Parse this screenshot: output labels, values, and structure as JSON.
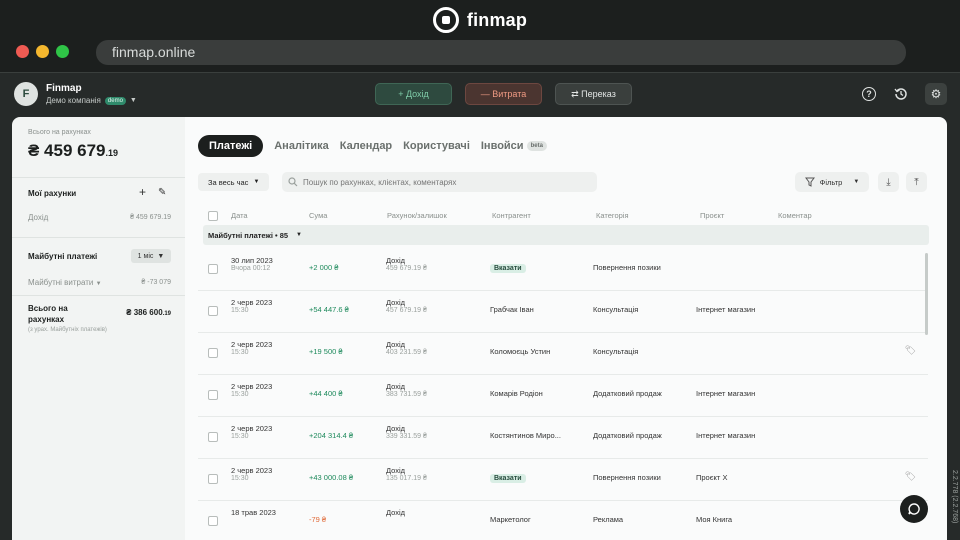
{
  "brand": {
    "name": "finmap"
  },
  "browser": {
    "url": "finmap.online"
  },
  "company": {
    "avatar": "F",
    "name": "Finmap",
    "sub": "Демо компанія",
    "badge": "demo"
  },
  "actions": {
    "income": "+ Дохід",
    "expense": "— Витрата",
    "transfer": "⇄ Переказ"
  },
  "sidebar": {
    "total_label": "Всього на рахунках",
    "total_main": "₴ 459 679",
    "total_cents": ".19",
    "accounts_title": "Мої рахунки",
    "accounts": [
      {
        "label": "Дохід",
        "value": "₴ 459 679.19"
      }
    ],
    "future_title": "Майбутні платежі",
    "future_period": "1 міс",
    "future_expense_label": "Майбутні витрати",
    "future_expense_value": "₴ -73 079",
    "sum_title": "Всього на рахунках",
    "sum_value": "₴ 386 600",
    "sum_cents": ".19",
    "sum_note": "(з урах. Майбутніх платежів)"
  },
  "tabs": [
    {
      "label": "Платежі"
    },
    {
      "label": "Аналітика"
    },
    {
      "label": "Календар"
    },
    {
      "label": "Користувачі"
    },
    {
      "label": "Інвойси",
      "badge": "beta"
    }
  ],
  "filters": {
    "period": "За весь час",
    "search_placeholder": "Пошук по рахунках, клієнтах, коментарях",
    "filter_label": "Фільтр"
  },
  "columns": [
    "Дата",
    "Сума",
    "Рахунок/залишок",
    "Контрагент",
    "Категорія",
    "Проєкт",
    "Коментар"
  ],
  "group": {
    "label": "Майбутні платежі • 85"
  },
  "rows": [
    {
      "date": "30 лип 2023",
      "time": "Вчора 00:12",
      "amount": "+2 000 ₴",
      "sign": "pos",
      "account": "Дохід",
      "balance": "459 679.19 ₴",
      "counterparty": "",
      "counterparty_tag": "Вказати",
      "category": "Повернення позики",
      "project": "",
      "tag_icon": false
    },
    {
      "date": "2 черв 2023",
      "time": "15:30",
      "amount": "+54 447.6 ₴",
      "sign": "pos",
      "account": "Дохід",
      "balance": "457 679.19 ₴",
      "counterparty": "Грабчак Іван",
      "counterparty_tag": "",
      "category": "Консультація",
      "project": "Інтернет магазин",
      "tag_icon": false
    },
    {
      "date": "2 черв 2023",
      "time": "15:30",
      "amount": "+19 500 ₴",
      "sign": "pos",
      "account": "Дохід",
      "balance": "403 231.59 ₴",
      "counterparty": "Коломоєць Устин",
      "counterparty_tag": "",
      "category": "Консультація",
      "project": "",
      "tag_icon": true
    },
    {
      "date": "2 черв 2023",
      "time": "15:30",
      "amount": "+44 400 ₴",
      "sign": "pos",
      "account": "Дохід",
      "balance": "383 731.59 ₴",
      "counterparty": "Комарів Родіон",
      "counterparty_tag": "",
      "category": "Додатковий продаж",
      "project": "Інтернет магазин",
      "tag_icon": false
    },
    {
      "date": "2 черв 2023",
      "time": "15:30",
      "amount": "+204 314.4 ₴",
      "sign": "pos",
      "account": "Дохід",
      "balance": "339 331.59 ₴",
      "counterparty": "Костянтинов Миро...",
      "counterparty_tag": "",
      "category": "Додатковий продаж",
      "project": "Інтернет магазин",
      "tag_icon": false
    },
    {
      "date": "2 черв 2023",
      "time": "15:30",
      "amount": "+43 000.08 ₴",
      "sign": "pos",
      "account": "Дохід",
      "balance": "135 017.19 ₴",
      "counterparty": "",
      "counterparty_tag": "Вказати",
      "category": "Повернення позики",
      "project": "Проєкт X",
      "tag_icon": true
    },
    {
      "date": "18 трав 2023",
      "time": "",
      "amount": "-79 ₴",
      "sign": "neg",
      "account": "Дохід",
      "balance": "",
      "counterparty": "Маркетолог",
      "counterparty_tag": "",
      "category": "Реклама",
      "project": "Моя Книга",
      "tag_icon": false
    }
  ],
  "version": "2.2.778 (2.2.768)"
}
